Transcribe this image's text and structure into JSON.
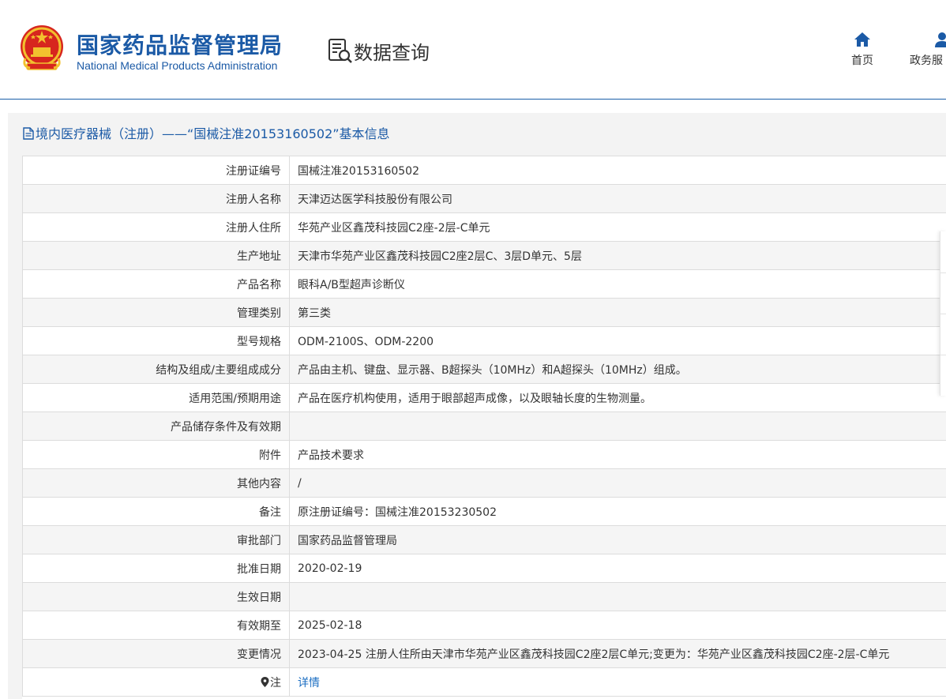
{
  "header": {
    "brand_cn": "国家药品监督管理局",
    "brand_en": "National Medical Products Administration",
    "section_title": "数据查询",
    "nav": [
      {
        "label": "首页",
        "icon": "home-icon"
      },
      {
        "label": "政务服",
        "icon": "user-icon"
      }
    ]
  },
  "panel": {
    "title": "境内医疗器械（注册）——“国械注准20153160502”基本信息"
  },
  "rows": [
    {
      "key": "注册证编号",
      "value": "国械注准20153160502"
    },
    {
      "key": "注册人名称",
      "value": "天津迈达医学科技股份有限公司"
    },
    {
      "key": "注册人住所",
      "value": "华苑产业区鑫茂科技园C2座-2层-C单元"
    },
    {
      "key": "生产地址",
      "value": "天津市华苑产业区鑫茂科技园C2座2层C、3层D单元、5层"
    },
    {
      "key": "产品名称",
      "value": "眼科A/B型超声诊断仪"
    },
    {
      "key": "管理类别",
      "value": "第三类"
    },
    {
      "key": "型号规格",
      "value": "ODM-2100S、ODM-2200"
    },
    {
      "key": "结构及组成/主要组成成分",
      "value": "产品由主机、键盘、显示器、B超探头（10MHz）和A超探头（10MHz）组成。"
    },
    {
      "key": "适用范围/预期用途",
      "value": "产品在医疗机构使用，适用于眼部超声成像，以及眼轴长度的生物测量。"
    },
    {
      "key": "产品储存条件及有效期",
      "value": ""
    },
    {
      "key": "附件",
      "value": "产品技术要求"
    },
    {
      "key": "其他内容",
      "value": "/"
    },
    {
      "key": "备注",
      "value": "原注册证编号：国械注准20153230502"
    },
    {
      "key": "审批部门",
      "value": "国家药品监督管理局"
    },
    {
      "key": "批准日期",
      "value": "2020-02-19"
    },
    {
      "key": "生效日期",
      "value": ""
    },
    {
      "key": "有效期至",
      "value": "2025-02-18"
    },
    {
      "key": "变更情况",
      "value": "2023-04-25 注册人住所由天津市华苑产业区鑫茂科技园C2座2层C单元;变更为：华苑产业区鑫茂科技园C2座-2层-C单元"
    }
  ],
  "note_row": {
    "key": "注",
    "icon": "pin-icon",
    "link": "详情"
  },
  "colors": {
    "brand": "#1b5aa6",
    "link": "#1b6ec2",
    "emblem_red": "#d7261e",
    "emblem_gold": "#f2c12e"
  }
}
